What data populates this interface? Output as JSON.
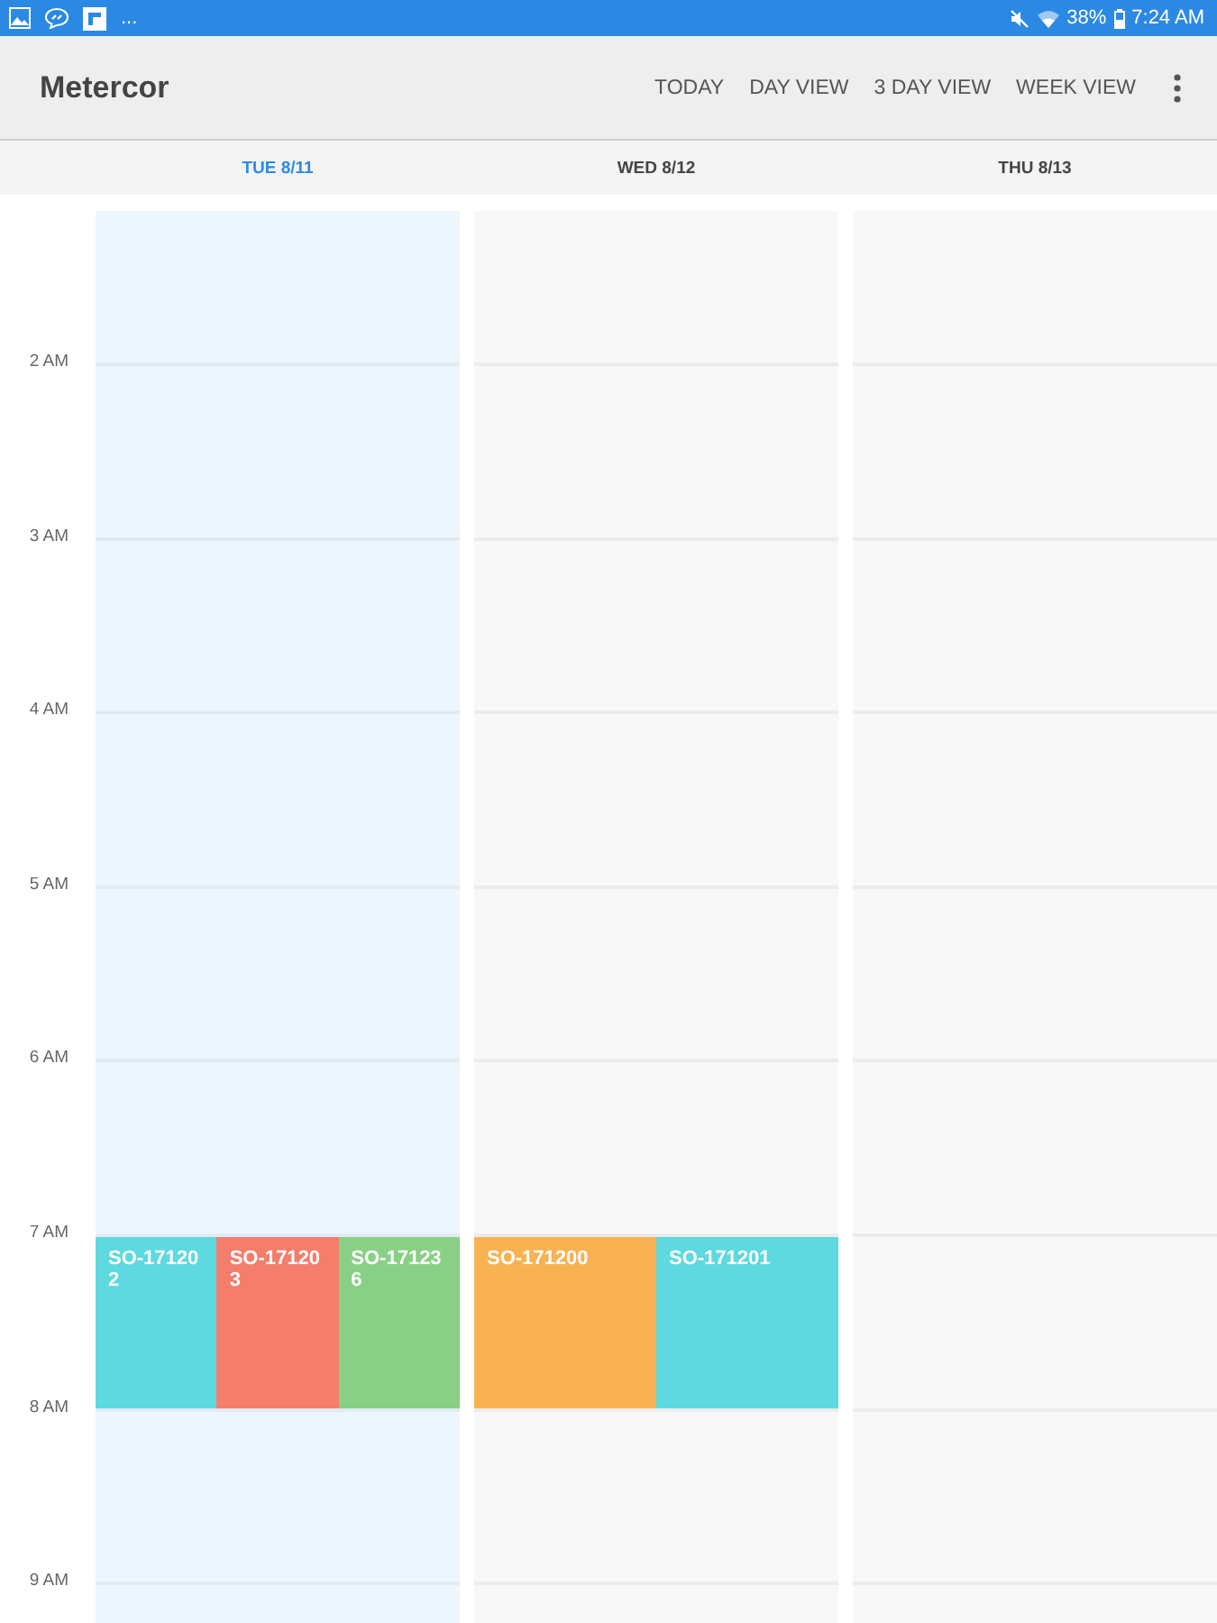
{
  "status_bar": {
    "overflow": "...",
    "battery": "38%",
    "time": "7:24 AM"
  },
  "app_bar": {
    "title": "Metercor",
    "actions": [
      "TODAY",
      "DAY VIEW",
      "3 DAY VIEW",
      "WEEK VIEW"
    ]
  },
  "days": [
    {
      "label": "TUE 8/11",
      "selected": true
    },
    {
      "label": "WED 8/12",
      "selected": false
    },
    {
      "label": "THU 8/13",
      "selected": false
    }
  ],
  "hours": [
    {
      "label": "2 AM"
    },
    {
      "label": "3 AM"
    },
    {
      "label": "4 AM"
    },
    {
      "label": "5 AM"
    },
    {
      "label": "6 AM"
    },
    {
      "label": "7 AM",
      "day_events": [
        [
          {
            "title": "SO-171202",
            "color": "#5dd9df"
          },
          {
            "title": "SO-171203",
            "color": "#f47d6b"
          },
          {
            "title": "SO-171236",
            "color": "#88d086"
          }
        ],
        [
          {
            "title": "SO-171200",
            "color": "#f8b251"
          },
          {
            "title": "SO-171201",
            "color": "#5dd9df"
          }
        ]
      ]
    },
    {
      "label": "8 AM"
    },
    {
      "label": "9 AM"
    }
  ]
}
